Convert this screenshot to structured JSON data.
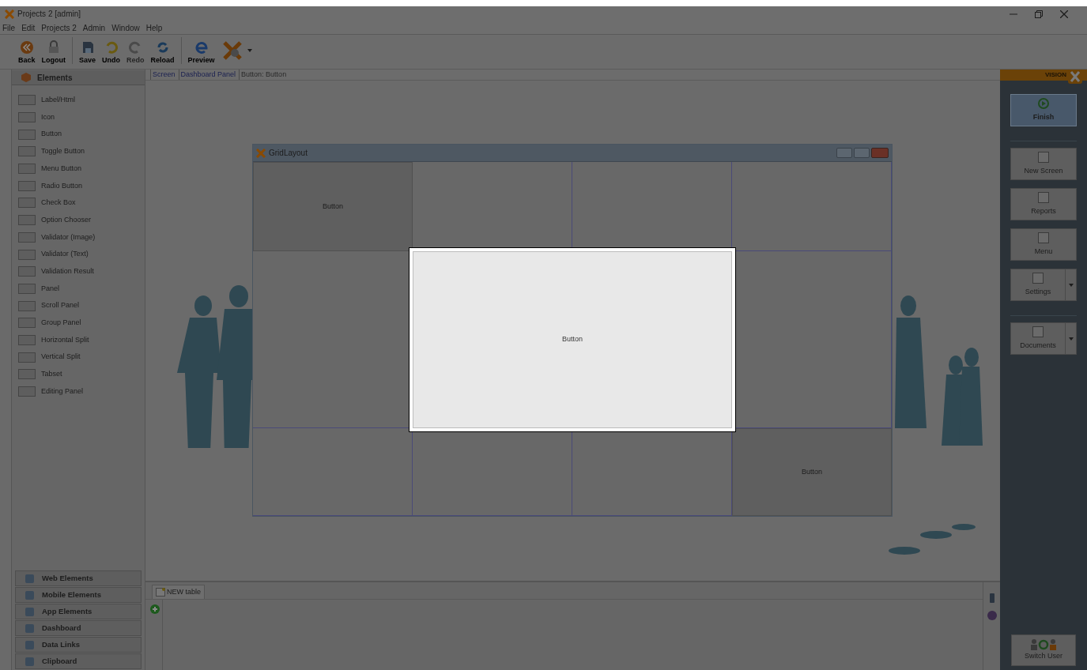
{
  "window": {
    "title": "Projects 2 [admin]"
  },
  "menu": [
    "File",
    "Edit",
    "Projects 2",
    "Admin",
    "Window",
    "Help"
  ],
  "toolbar": [
    {
      "label": "Back",
      "kind": "back",
      "disabled": false
    },
    {
      "label": "Logout",
      "kind": "lock",
      "disabled": false
    },
    {
      "label": "Save",
      "kind": "save",
      "disabled": false,
      "sep_before": true
    },
    {
      "label": "Undo",
      "kind": "undo",
      "disabled": false
    },
    {
      "label": "Redo",
      "kind": "redo",
      "disabled": true
    },
    {
      "label": "Reload",
      "kind": "reload",
      "disabled": false
    },
    {
      "label": "Preview",
      "kind": "preview",
      "disabled": false,
      "sep_before": true
    }
  ],
  "left_panel": {
    "header": "Elements",
    "items": [
      "Label/Html",
      "Icon",
      "Button",
      "Toggle Button",
      "Menu Button",
      "Radio Button",
      "Check Box",
      "Option Chooser",
      "Validator (Image)",
      "Validator (Text)",
      "Validation Result",
      "Panel",
      "Scroll Panel",
      "Group Panel",
      "Horizontal Split",
      "Vertical Split",
      "Tabset",
      "Editing Panel"
    ],
    "sections": [
      "Web Elements",
      "Mobile Elements",
      "App Elements",
      "Dashboard",
      "Data Links",
      "Clipboard"
    ]
  },
  "breadcrumb": [
    "Screen",
    "Dashboard Panel",
    "Button: Button"
  ],
  "grid_window": {
    "title": "GridLayout",
    "buttons": [
      {
        "label": "Button",
        "selected": false
      },
      {
        "label": "Button",
        "selected": true
      },
      {
        "label": "Button",
        "selected": false
      }
    ]
  },
  "bottom_panel": {
    "tabs": [
      {
        "label": "NEW table",
        "selected": true
      }
    ]
  },
  "right_panel": {
    "brand": "VISION",
    "buttons": [
      {
        "label": "Finish",
        "selected": true,
        "dropdown": false
      },
      {
        "label": "New Screen",
        "selected": false,
        "dropdown": false
      },
      {
        "label": "Reports",
        "selected": false,
        "dropdown": false
      },
      {
        "label": "Menu",
        "selected": false,
        "dropdown": false
      },
      {
        "label": "Settings",
        "selected": false,
        "dropdown": true
      },
      {
        "label": "Documents",
        "selected": false,
        "dropdown": true
      }
    ],
    "footer_button": "Switch User"
  }
}
